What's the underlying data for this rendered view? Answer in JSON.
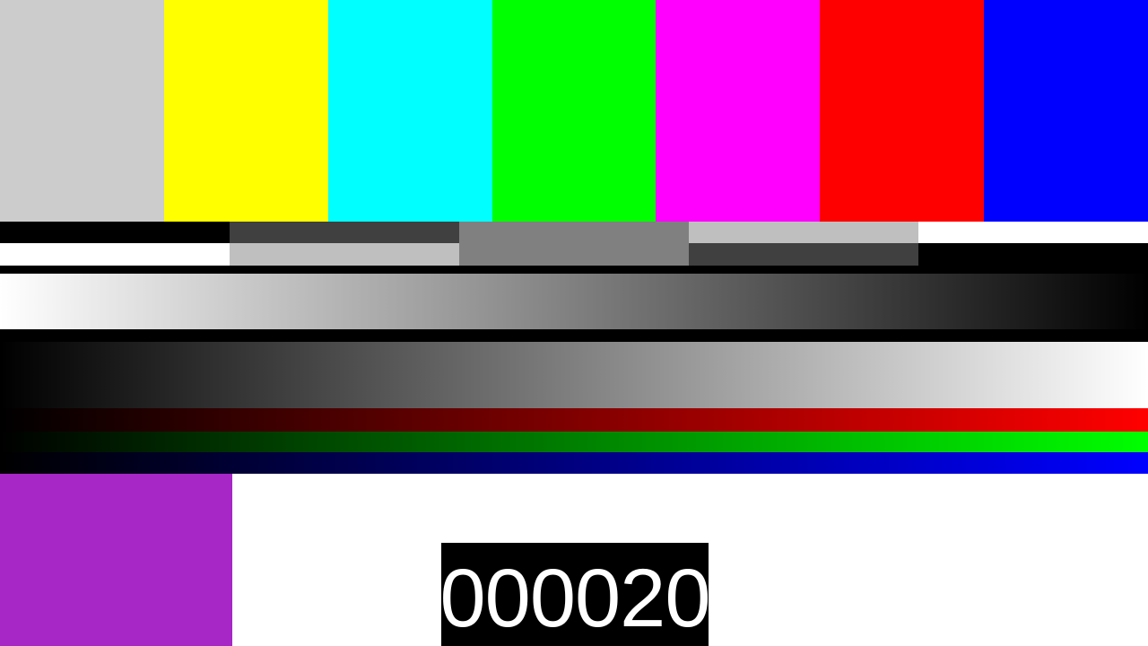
{
  "test_pattern": {
    "top_bars": [
      "#cccccc",
      "#ffff00",
      "#00ffff",
      "#00ff00",
      "#ff00ff",
      "#ff0000",
      "#0000ff"
    ],
    "gray_steps": {
      "upper": [
        "#000000",
        "#404040",
        "#808080",
        "#bfbfbf",
        "#ffffff"
      ],
      "lower": [
        "#ffffff",
        "#bfbfbf",
        "#808080",
        "#404040",
        "#000000"
      ]
    },
    "gradients": {
      "luma_down": [
        "#ffffff",
        "#000000"
      ],
      "luma_up": [
        "#000000",
        "#ffffff"
      ],
      "red": [
        "#000000",
        "#ff0000"
      ],
      "green": [
        "#000000",
        "#00ff00"
      ],
      "blue": [
        "#000000",
        "#0000ff"
      ]
    },
    "bottom_swatch_color": "#a626c6",
    "frame_counter": "000020"
  }
}
